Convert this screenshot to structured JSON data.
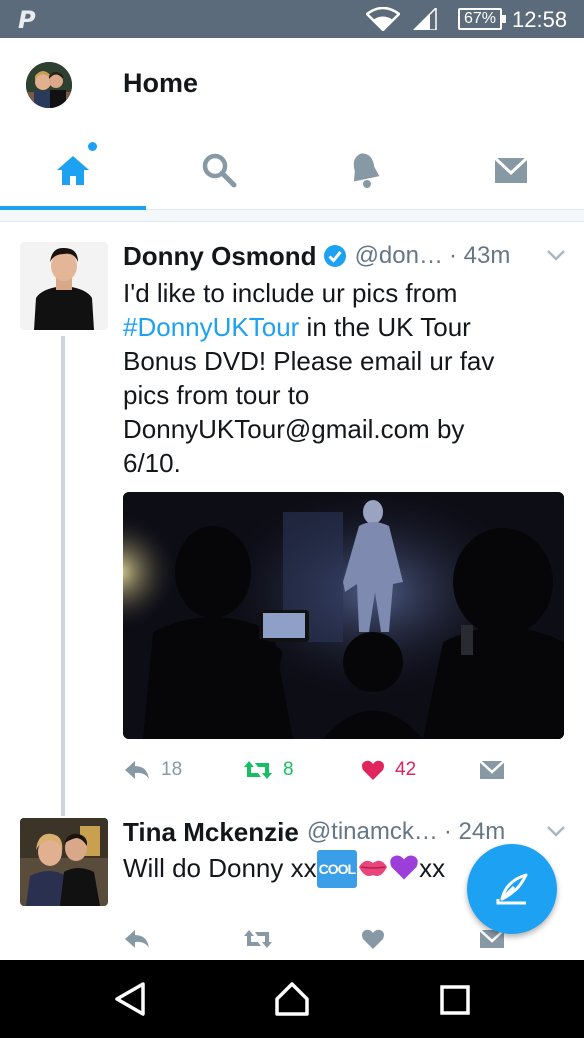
{
  "status_bar": {
    "battery": "67%",
    "time": "12:58",
    "app_icon": "paypal-icon"
  },
  "header": {
    "title": "Home",
    "avatar": "profile-avatar"
  },
  "tabs": [
    {
      "name": "home",
      "icon": "home-icon",
      "active": true
    },
    {
      "name": "search",
      "icon": "search-icon",
      "active": false
    },
    {
      "name": "notifications",
      "icon": "bell-icon",
      "active": false
    },
    {
      "name": "messages",
      "icon": "envelope-icon",
      "active": false
    }
  ],
  "tweets": [
    {
      "name": "Donny Osmond",
      "verified": true,
      "handle": "@don…",
      "time": "· 43m",
      "text_lines": [
        "I'd like to include ur pics from",
        "#DonnyUKTour",
        " in the UK Tour",
        "Bonus DVD! Please email ur fav",
        "pics from tour to",
        "DonnyUKTour@gmail.com by",
        "6/10."
      ],
      "has_media": true,
      "replies": "18",
      "retweets": "8",
      "likes": "42"
    },
    {
      "name": "Tina Mckenzie",
      "verified": false,
      "handle": "@tinamck…",
      "time": "· 24m",
      "text_prefix": "Will do Donny xx",
      "emoji_cool": "COOL",
      "text_suffix": "xx"
    }
  ],
  "colors": {
    "accent": "#1da1f2",
    "status_bar": "#5b6b7b",
    "retweet": "#17bf63",
    "like": "#e0245e"
  },
  "nav_bar": [
    "back-icon",
    "home-circle-icon",
    "recents-icon"
  ]
}
